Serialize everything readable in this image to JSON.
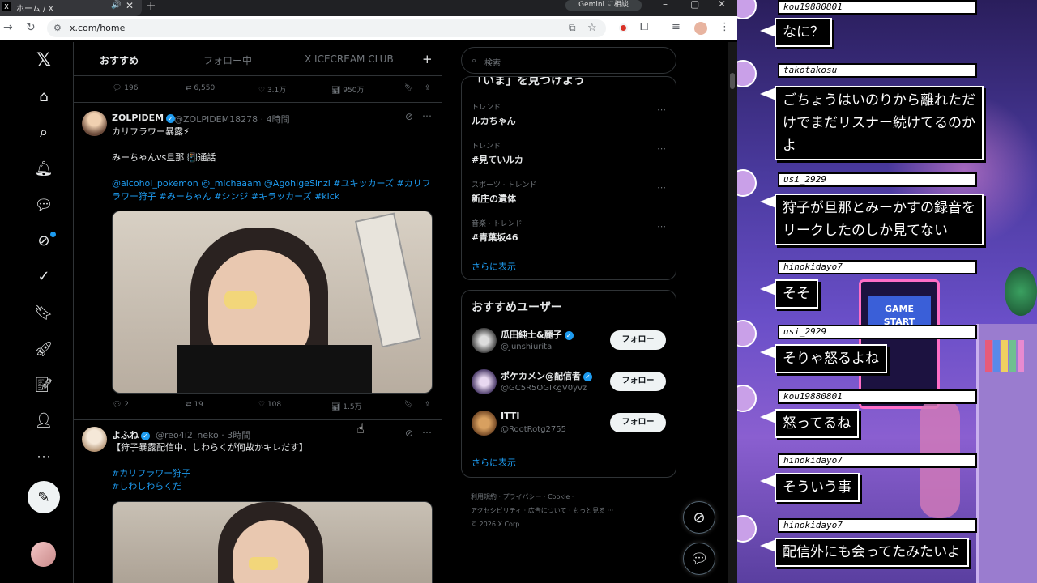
{
  "browser": {
    "tab_title": "ホーム / X",
    "tab_icon": "X",
    "new_tab": "+",
    "gemini": "Gemini に相談",
    "url": "x.com/home",
    "window_controls": [
      "–",
      "▢",
      "✕"
    ]
  },
  "feed": {
    "tabs": [
      "おすすめ",
      "フォロー中",
      "X ICECREAM CLUB"
    ],
    "add_tab": "+",
    "top_actions": {
      "replies": "196",
      "reposts": "6,550",
      "likes": "3.1万",
      "views": "950万"
    },
    "tweets": [
      {
        "name": "ZOLPIDEM",
        "handle": "@ZOLPIDEM18278 · 4時間",
        "lines": [
          "カリフラワー暴露⚡",
          "",
          "みーちゃんvs旦那 📳通話"
        ],
        "links": "@alcohol_pokemon @_michaaam @AgohigeSinzi #ユキッカーズ #カリフラワー狩子 #みーちゃん #シンジ #キラッカーズ #kick",
        "actions": {
          "replies": "2",
          "reposts": "19",
          "likes": "108",
          "views": "1.5万"
        }
      },
      {
        "name": "よふね",
        "handle": "@reo4i2_neko · 3時間",
        "lines": [
          "【狩子暴露配信中、しわらくが何故かキレだす】"
        ],
        "links": "#カリフラワー狩子\n#しわしわらくだ"
      }
    ]
  },
  "sidebar": {
    "search_placeholder": "検索",
    "trends_title": "「いま」を見つけよう",
    "trends": [
      {
        "context": "トレンド",
        "name": "ルカちゃん"
      },
      {
        "context": "トレンド",
        "name": "#見ていルカ"
      },
      {
        "context": "スポーツ · トレンド",
        "name": "新庄の遺体"
      },
      {
        "context": "音楽 · トレンド",
        "name": "#青葉坂46"
      }
    ],
    "show_more": "さらに表示",
    "who_title": "おすすめユーザー",
    "follow_label": "フォロー",
    "users": [
      {
        "name": "瓜田純士&麗子",
        "handle": "@Junshiurita"
      },
      {
        "name": "ポケカメン@配信者",
        "handle": "@GC5R5OGIKgV0yvz"
      },
      {
        "name": "ITTI",
        "handle": "@RootRotg2755"
      }
    ],
    "footer": [
      "利用規約 · プライバシー · Cookie ·",
      "アクセシビリティ · 広告について · もっと見る ···",
      "© 2026 X Corp."
    ]
  },
  "stream": {
    "comments": [
      {
        "user": "kou19880801",
        "text": [
          "なに？"
        ]
      },
      {
        "user": "takotakosu",
        "text": [
          "ごちょうはいのりから離れただ",
          "けでまだリスナー続けてるのか",
          "よ"
        ]
      },
      {
        "user": "usi_2929",
        "text": [
          "狩子が旦那とみーかすの録音を",
          "リークしたのしか見てない"
        ]
      },
      {
        "user": "hinokidayo7",
        "text": [
          "そそ"
        ]
      },
      {
        "user": "usi_2929",
        "text": [
          "そりゃ怒るよね"
        ]
      },
      {
        "user": "kou19880801",
        "text": [
          "怒ってるね"
        ]
      },
      {
        "user": "hinokidayo7",
        "text": [
          "そういう事"
        ]
      },
      {
        "user": "hinokidayo7",
        "text": [
          "配信外にも会ってたみたいよ"
        ]
      }
    ],
    "arcade_text": "GAME START"
  }
}
